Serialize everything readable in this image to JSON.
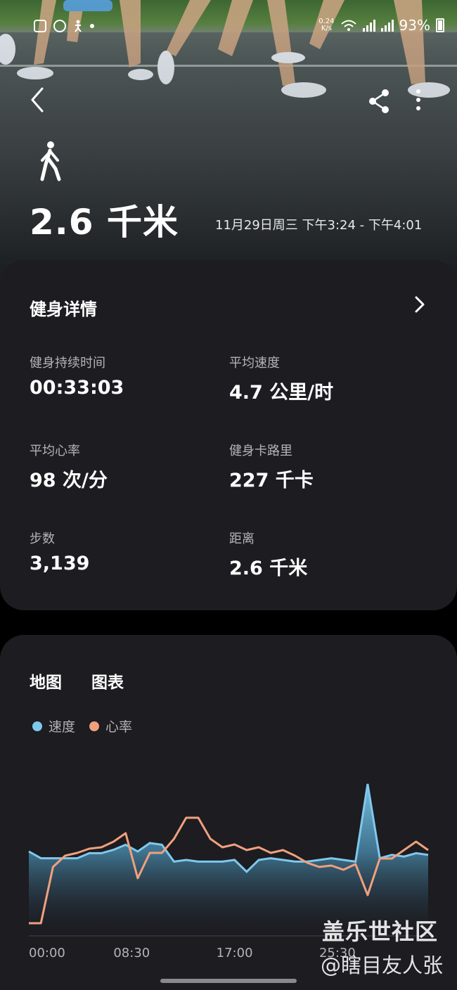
{
  "status_bar": {
    "net_speed": "0.24\nK/s",
    "battery": "93%",
    "network_1": "5G",
    "network_2": "5G"
  },
  "header": {
    "distance": "2.6 千米",
    "date_range": "11月29日周三 下午3:24 - 下午4:01",
    "activity_icon": "walking-icon"
  },
  "details": {
    "title": "健身详情",
    "stats": [
      {
        "label": "健身持续时间",
        "value": "00:33:03"
      },
      {
        "label": "平均速度",
        "value": "4.7 公里/时"
      },
      {
        "label": "平均心率",
        "value": "98 次/分"
      },
      {
        "label": "健身卡路里",
        "value": "227 千卡"
      },
      {
        "label": "步数",
        "value": "3,139"
      },
      {
        "label": "距离",
        "value": "2.6 千米"
      }
    ]
  },
  "chart_section": {
    "tabs": [
      "地图",
      "图表"
    ],
    "legend": [
      {
        "name": "速度",
        "color": "#7fc8ec"
      },
      {
        "name": "心率",
        "color": "#f0a07e"
      }
    ]
  },
  "chart_data": {
    "type": "area",
    "x": [
      0,
      1,
      2,
      3,
      4,
      5,
      6,
      7,
      8,
      9,
      10,
      11,
      12,
      13,
      14,
      15,
      16,
      17,
      18,
      19,
      20,
      21,
      22,
      23,
      24,
      25,
      26,
      27,
      28,
      29,
      30,
      31,
      32,
      33
    ],
    "x_tick_labels": [
      "00:00",
      "08:30",
      "17:00",
      "25:30"
    ],
    "series": [
      {
        "name": "速度",
        "color": "#7fc8ec",
        "values": [
          5.0,
          4.6,
          4.6,
          4.6,
          4.6,
          4.9,
          4.9,
          5.1,
          5.4,
          5.0,
          5.5,
          5.4,
          4.4,
          4.5,
          4.4,
          4.4,
          4.4,
          4.5,
          3.8,
          4.5,
          4.6,
          4.5,
          4.4,
          4.4,
          4.5,
          4.6,
          4.5,
          4.4,
          9.0,
          4.6,
          4.8,
          4.7,
          4.9,
          4.8
        ]
      },
      {
        "name": "心率",
        "color": "#f0a07e",
        "values": [
          60,
          60,
          100,
          108,
          110,
          113,
          114,
          118,
          124,
          92,
          110,
          110,
          120,
          135,
          135,
          120,
          114,
          116,
          112,
          114,
          110,
          112,
          108,
          103,
          100,
          101,
          98,
          102,
          80,
          106,
          106,
          112,
          118,
          112
        ]
      }
    ]
  },
  "watermark": {
    "line1": "盖乐世社区",
    "line2": "@瞎目友人张"
  }
}
